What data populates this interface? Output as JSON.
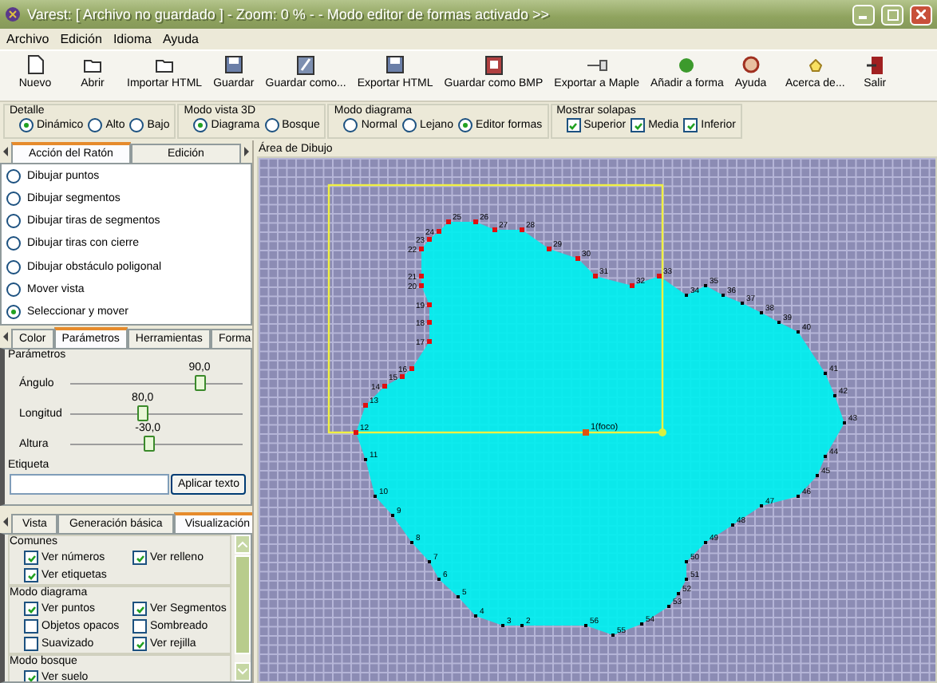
{
  "window": {
    "title": "Varest: [ Archivo no guardado ] - Zoom: 0 % - - Modo editor de formas activado >>"
  },
  "menu": [
    "Archivo",
    "Edición",
    "Idioma",
    "Ayuda"
  ],
  "toolbar": [
    {
      "label": "Nuevo"
    },
    {
      "label": "Abrir"
    },
    {
      "label": "Importar HTML"
    },
    {
      "label": "Guardar"
    },
    {
      "label": "Guardar como..."
    },
    {
      "label": "Exportar HTML"
    },
    {
      "label": "Guardar como BMP"
    },
    {
      "label": "Exportar a Maple"
    },
    {
      "label": "Añadir a forma"
    },
    {
      "label": "Ayuda"
    },
    {
      "label": "Acerca de..."
    },
    {
      "label": "Salir"
    }
  ],
  "options": [
    {
      "title": "Detalle",
      "items": [
        {
          "kind": "radio",
          "label": "Dinámico",
          "selected": true
        },
        {
          "kind": "radio",
          "label": "Alto",
          "selected": false
        },
        {
          "kind": "radio",
          "label": "Bajo",
          "selected": false
        }
      ]
    },
    {
      "title": "Modo vista 3D",
      "items": [
        {
          "kind": "radio",
          "label": "Diagrama",
          "selected": true
        },
        {
          "kind": "radio",
          "label": "Bosque",
          "selected": false
        }
      ]
    },
    {
      "title": "Modo diagrama",
      "items": [
        {
          "kind": "radio",
          "label": "Normal",
          "selected": false
        },
        {
          "kind": "radio",
          "label": "Lejano",
          "selected": false
        },
        {
          "kind": "radio",
          "label": "Editor formas",
          "selected": true
        }
      ]
    },
    {
      "title": "Mostrar solapas",
      "items": [
        {
          "kind": "checkbox",
          "label": "Superior",
          "checked": true
        },
        {
          "kind": "checkbox",
          "label": "Media",
          "checked": true
        },
        {
          "kind": "checkbox",
          "label": "Inferior",
          "checked": true
        }
      ]
    }
  ],
  "mouse_tabs": [
    {
      "label": "Acción del Ratón",
      "selected": true
    },
    {
      "label": "Edición",
      "selected": false
    }
  ],
  "mouse_actions": [
    {
      "label": "Dibujar puntos",
      "selected": false
    },
    {
      "label": "Dibujar segmentos",
      "selected": false
    },
    {
      "label": "Dibujar tiras de segmentos",
      "selected": false
    },
    {
      "label": "Dibujar tiras con cierre",
      "selected": false
    },
    {
      "label": "Dibujar obstáculo poligonal",
      "selected": false
    },
    {
      "label": "Mover vista",
      "selected": false
    },
    {
      "label": "Seleccionar y mover",
      "selected": true
    }
  ],
  "param_tabs": [
    {
      "label": "Color",
      "selected": false
    },
    {
      "label": "Parámetros",
      "selected": true
    },
    {
      "label": "Herramientas",
      "selected": false
    },
    {
      "label": "Forma",
      "selected": false
    }
  ],
  "parameters": {
    "title": "Parámetros",
    "sliders": [
      {
        "label": "Ángulo",
        "reading": "90,0",
        "level": 0.75
      },
      {
        "label": "Longitud",
        "reading": "80,0",
        "level": 0.42
      },
      {
        "label": "Altura",
        "reading": "-30,0",
        "level": 0.45
      }
    ],
    "tag_title": "Etiqueta",
    "tag_button": "Aplicar texto"
  },
  "view_tabs": [
    {
      "label": "Vista",
      "selected": false
    },
    {
      "label": "Generación básica",
      "selected": false
    },
    {
      "label": "Visualización",
      "selected": true
    }
  ],
  "visualization": [
    {
      "title": "Comunes",
      "items": [
        {
          "label": "Ver números",
          "checked": true
        },
        {
          "label": "Ver relleno",
          "checked": true
        },
        {
          "label": "Ver etiquetas",
          "checked": true
        }
      ]
    },
    {
      "title": "Modo diagrama",
      "items": [
        {
          "label": "Ver puntos",
          "checked": true
        },
        {
          "label": "Ver Segmentos",
          "checked": true
        },
        {
          "label": "Objetos opacos",
          "checked": false
        },
        {
          "label": "Sombreado",
          "checked": false
        },
        {
          "label": "Suavizado",
          "checked": false
        },
        {
          "label": "Ver rejilla",
          "checked": true
        }
      ]
    },
    {
      "title": "Modo bosque",
      "items": [
        {
          "label": "Ver suelo",
          "checked": true
        }
      ]
    }
  ],
  "drawing": {
    "title": "Área de Dibujo",
    "focus": {
      "label": "1(foco)",
      "selected": true
    },
    "points": [
      {
        "label": "25",
        "selected": true
      },
      {
        "label": "26",
        "selected": true
      },
      {
        "label": "24",
        "selected": true
      },
      {
        "label": "27",
        "selected": true
      },
      {
        "label": "28",
        "selected": true
      },
      {
        "label": "23",
        "selected": true
      },
      {
        "label": "22",
        "selected": true
      },
      {
        "label": "29",
        "selected": true
      },
      {
        "label": "30",
        "selected": true
      },
      {
        "label": "21",
        "selected": true
      },
      {
        "label": "31",
        "selected": true
      },
      {
        "label": "33",
        "selected": true
      },
      {
        "label": "20",
        "selected": true
      },
      {
        "label": "32",
        "selected": true
      },
      {
        "label": "35",
        "selected": false
      },
      {
        "label": "34",
        "selected": false
      },
      {
        "label": "36",
        "selected": false
      },
      {
        "label": "19",
        "selected": true
      },
      {
        "label": "37",
        "selected": false
      },
      {
        "label": "38",
        "selected": false
      },
      {
        "label": "18",
        "selected": true
      },
      {
        "label": "39",
        "selected": false
      },
      {
        "label": "40",
        "selected": false
      },
      {
        "label": "17",
        "selected": true
      },
      {
        "label": "16",
        "selected": true
      },
      {
        "label": "15",
        "selected": true
      },
      {
        "label": "41",
        "selected": false
      },
      {
        "label": "14",
        "selected": true
      },
      {
        "label": "42",
        "selected": false
      },
      {
        "label": "13",
        "selected": true
      },
      {
        "label": "43",
        "selected": false
      },
      {
        "label": "12",
        "selected": true
      },
      {
        "label": "11",
        "selected": false
      },
      {
        "label": "44",
        "selected": false
      },
      {
        "label": "45",
        "selected": false
      },
      {
        "label": "10",
        "selected": false
      },
      {
        "label": "46",
        "selected": false
      },
      {
        "label": "47",
        "selected": false
      },
      {
        "label": "9",
        "selected": false
      },
      {
        "label": "48",
        "selected": false
      },
      {
        "label": "8",
        "selected": false
      },
      {
        "label": "49",
        "selected": false
      },
      {
        "label": "7",
        "selected": false
      },
      {
        "label": "50",
        "selected": false
      },
      {
        "label": "6",
        "selected": false
      },
      {
        "label": "51",
        "selected": false
      },
      {
        "label": "5",
        "selected": false
      },
      {
        "label": "52",
        "selected": false
      },
      {
        "label": "53",
        "selected": false
      },
      {
        "label": "4",
        "selected": false
      },
      {
        "label": "3",
        "selected": false
      },
      {
        "label": "2",
        "selected": false
      },
      {
        "label": "56",
        "selected": false
      },
      {
        "label": "54",
        "selected": false
      },
      {
        "label": "55",
        "selected": false
      }
    ]
  }
}
